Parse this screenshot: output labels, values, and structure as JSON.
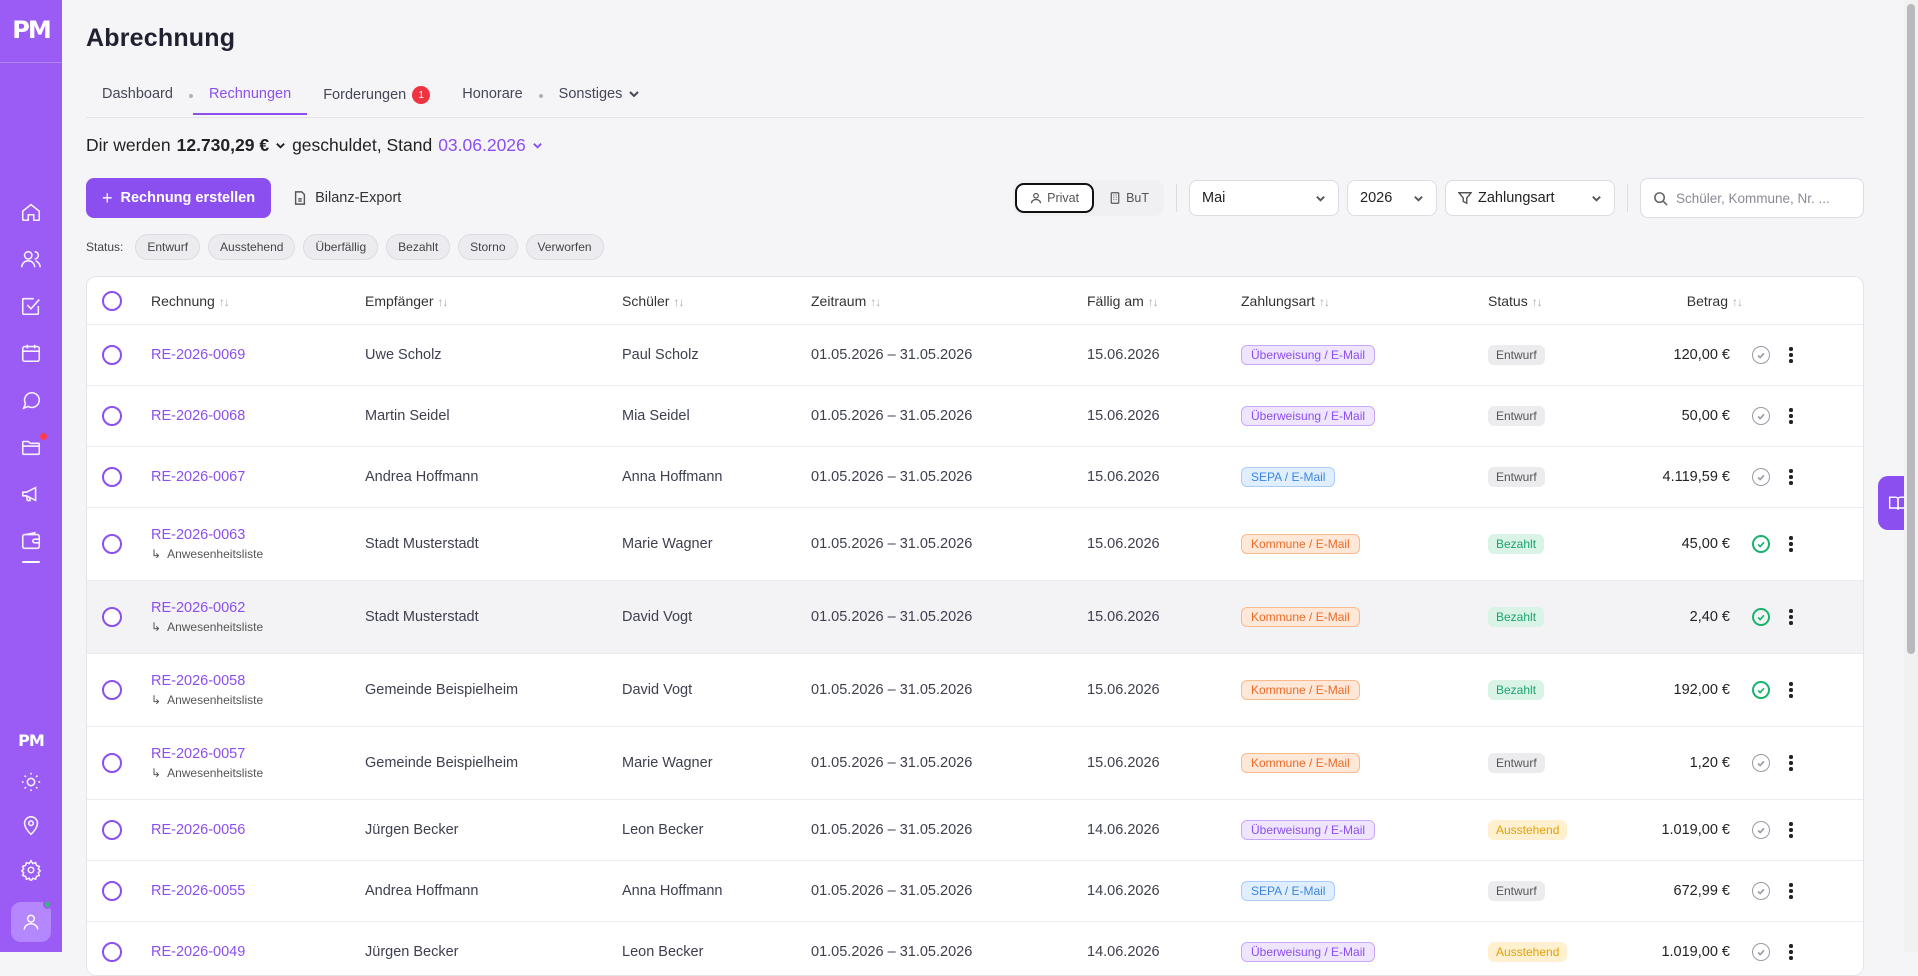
{
  "page": {
    "title": "Abrechnung"
  },
  "tabs": [
    {
      "label": "Dashboard"
    },
    {
      "label": "Rechnungen"
    },
    {
      "label": "Forderungen",
      "badge": "1"
    },
    {
      "label": "Honorare"
    },
    {
      "label": "Sonstiges"
    }
  ],
  "summary": {
    "prefix": "Dir werden",
    "amount": "12.730,29 €",
    "middle": "geschuldet, Stand",
    "date": "03.06.2026"
  },
  "toolbar": {
    "create_label": "Rechnung erstellen",
    "export_label": "Bilanz-Export",
    "seg_private": "Privat",
    "seg_but": "BuT",
    "month": "Mai",
    "year": "2026",
    "payment_filter": "Zahlungsart",
    "search_placeholder": "Schüler, Kommune, Nr. ..."
  },
  "status_filter": {
    "label": "Status:",
    "chips": [
      "Entwurf",
      "Ausstehend",
      "Überfällig",
      "Bezahlt",
      "Storno",
      "Verworfen"
    ]
  },
  "table": {
    "columns": [
      "Rechnung",
      "Empfänger",
      "Schüler",
      "Zeitraum",
      "Fällig am",
      "Zahlungsart",
      "Status",
      "Betrag"
    ],
    "rows": [
      {
        "nr": "RE-2026-0069",
        "sub": "",
        "recipient": "Uwe Scholz",
        "student": "Paul Scholz",
        "period": "01.05.2026 – 31.05.2026",
        "due": "15.06.2026",
        "payment": "Überweisung / E-Mail",
        "payment_color": "purple",
        "status": "Entwurf",
        "status_color": "gray",
        "amount": "120,00 €",
        "paid": false
      },
      {
        "nr": "RE-2026-0068",
        "sub": "",
        "recipient": "Martin Seidel",
        "student": "Mia Seidel",
        "period": "01.05.2026 – 31.05.2026",
        "due": "15.06.2026",
        "payment": "Überweisung / E-Mail",
        "payment_color": "purple",
        "status": "Entwurf",
        "status_color": "gray",
        "amount": "50,00 €",
        "paid": false
      },
      {
        "nr": "RE-2026-0067",
        "sub": "",
        "recipient": "Andrea Hoffmann",
        "student": "Anna Hoffmann",
        "period": "01.05.2026 – 31.05.2026",
        "due": "15.06.2026",
        "payment": "SEPA / E-Mail",
        "payment_color": "blue",
        "status": "Entwurf",
        "status_color": "gray",
        "amount": "4.119,59 €",
        "paid": false
      },
      {
        "nr": "RE-2026-0063",
        "sub": "Anwesenheitsliste",
        "recipient": "Stadt Musterstadt",
        "student": "Marie Wagner",
        "period": "01.05.2026 – 31.05.2026",
        "due": "15.06.2026",
        "payment": "Kommune / E-Mail",
        "payment_color": "orange",
        "status": "Bezahlt",
        "status_color": "green",
        "amount": "45,00 €",
        "paid": true
      },
      {
        "nr": "RE-2026-0062",
        "sub": "Anwesenheitsliste",
        "recipient": "Stadt Musterstadt",
        "student": "David Vogt",
        "period": "01.05.2026 – 31.05.2026",
        "due": "15.06.2026",
        "payment": "Kommune / E-Mail",
        "payment_color": "orange",
        "status": "Bezahlt",
        "status_color": "green",
        "amount": "2,40 €",
        "paid": true
      },
      {
        "nr": "RE-2026-0058",
        "sub": "Anwesenheitsliste",
        "recipient": "Gemeinde Beispielheim",
        "student": "David Vogt",
        "period": "01.05.2026 – 31.05.2026",
        "due": "15.06.2026",
        "payment": "Kommune / E-Mail",
        "payment_color": "orange",
        "status": "Bezahlt",
        "status_color": "green",
        "amount": "192,00 €",
        "paid": true
      },
      {
        "nr": "RE-2026-0057",
        "sub": "Anwesenheitsliste",
        "recipient": "Gemeinde Beispielheim",
        "student": "Marie Wagner",
        "period": "01.05.2026 – 31.05.2026",
        "due": "15.06.2026",
        "payment": "Kommune / E-Mail",
        "payment_color": "orange",
        "status": "Entwurf",
        "status_color": "gray",
        "amount": "1,20 €",
        "paid": false
      },
      {
        "nr": "RE-2026-0056",
        "sub": "",
        "recipient": "Jürgen Becker",
        "student": "Leon Becker",
        "period": "01.05.2026 – 31.05.2026",
        "due": "14.06.2026",
        "payment": "Überweisung / E-Mail",
        "payment_color": "purple",
        "status": "Ausstehend",
        "status_color": "yellow",
        "amount": "1.019,00 €",
        "paid": false
      },
      {
        "nr": "RE-2026-0055",
        "sub": "",
        "recipient": "Andrea Hoffmann",
        "student": "Anna Hoffmann",
        "period": "01.05.2026 – 31.05.2026",
        "due": "14.06.2026",
        "payment": "SEPA / E-Mail",
        "payment_color": "blue",
        "status": "Entwurf",
        "status_color": "gray",
        "amount": "672,99 €",
        "paid": false
      },
      {
        "nr": "RE-2026-0049",
        "sub": "",
        "recipient": "Jürgen Becker",
        "student": "Leon Becker",
        "period": "01.05.2026 – 31.05.2026",
        "due": "14.06.2026",
        "payment": "Überweisung / E-Mail",
        "payment_color": "purple",
        "status": "Ausstehend",
        "status_color": "yellow",
        "amount": "1.019,00 €",
        "paid": false
      }
    ]
  },
  "colors": {
    "accent": "#8b4ff0",
    "sidebar": "#9a5cf5",
    "paid": "#16b36d",
    "alert": "#ef3340"
  }
}
